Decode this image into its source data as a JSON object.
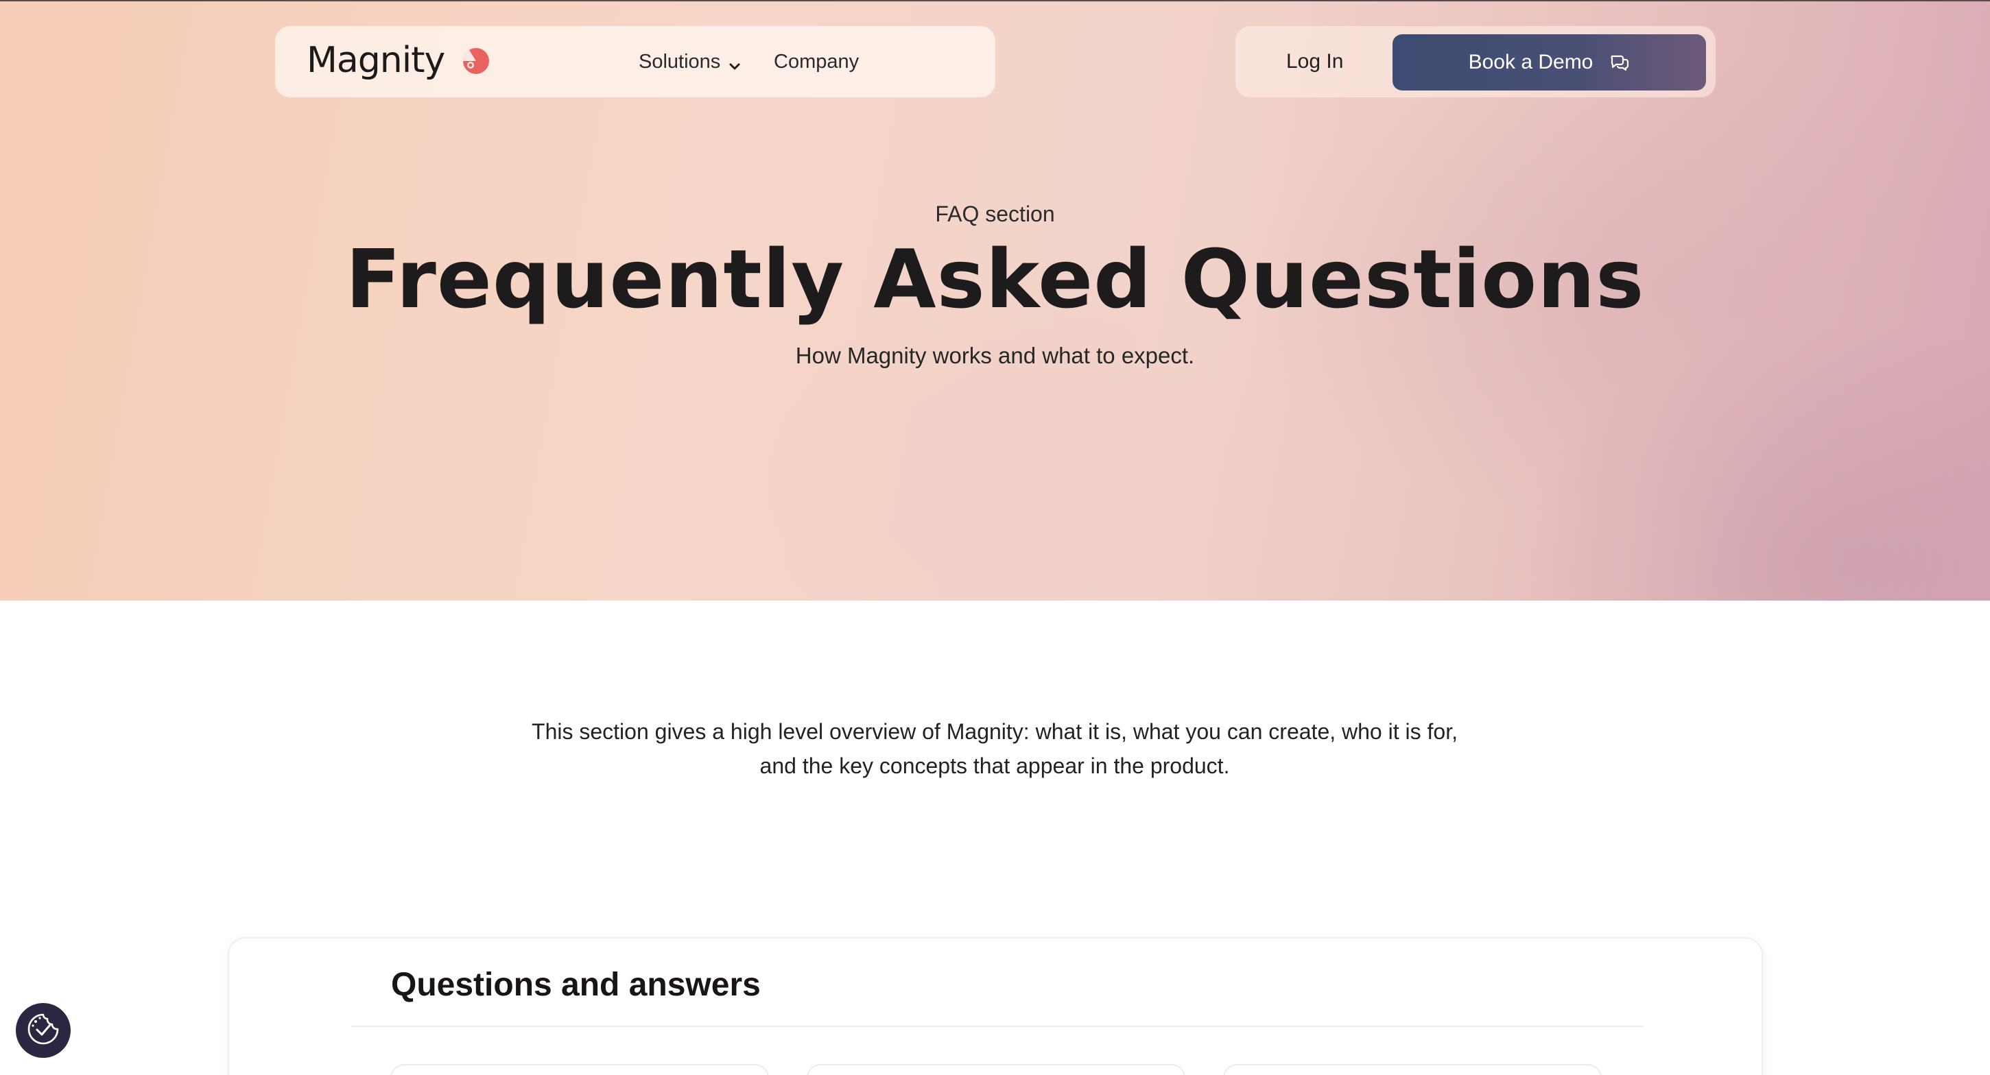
{
  "nav": {
    "logo_text": "Magnity",
    "solutions_label": "Solutions",
    "company_label": "Company",
    "login_label": "Log In",
    "demo_label": "Book a Demo"
  },
  "hero": {
    "eyebrow": "FAQ section",
    "title": "Frequently Asked Questions",
    "subtitle": "How Magnity works and what to expect."
  },
  "intro": {
    "line1": "This section gives a high level overview of Magnity: what it is, what you can create, who it is for,",
    "line2": "and the key concepts that appear in the product."
  },
  "qa": {
    "title": "Questions and answers"
  },
  "icons": {
    "logo_mark": "magnity-logo-mark-icon",
    "solutions_chevron": "chevron-down-icon",
    "demo_icon": "chat-bubbles-icon",
    "cookie_icon": "cookie-consent-icon"
  },
  "colors": {
    "brand_accent": "#e8625f",
    "button_start": "#3d4b72",
    "button_end": "#6d5a7a",
    "cookie_button": "#2d2642"
  }
}
